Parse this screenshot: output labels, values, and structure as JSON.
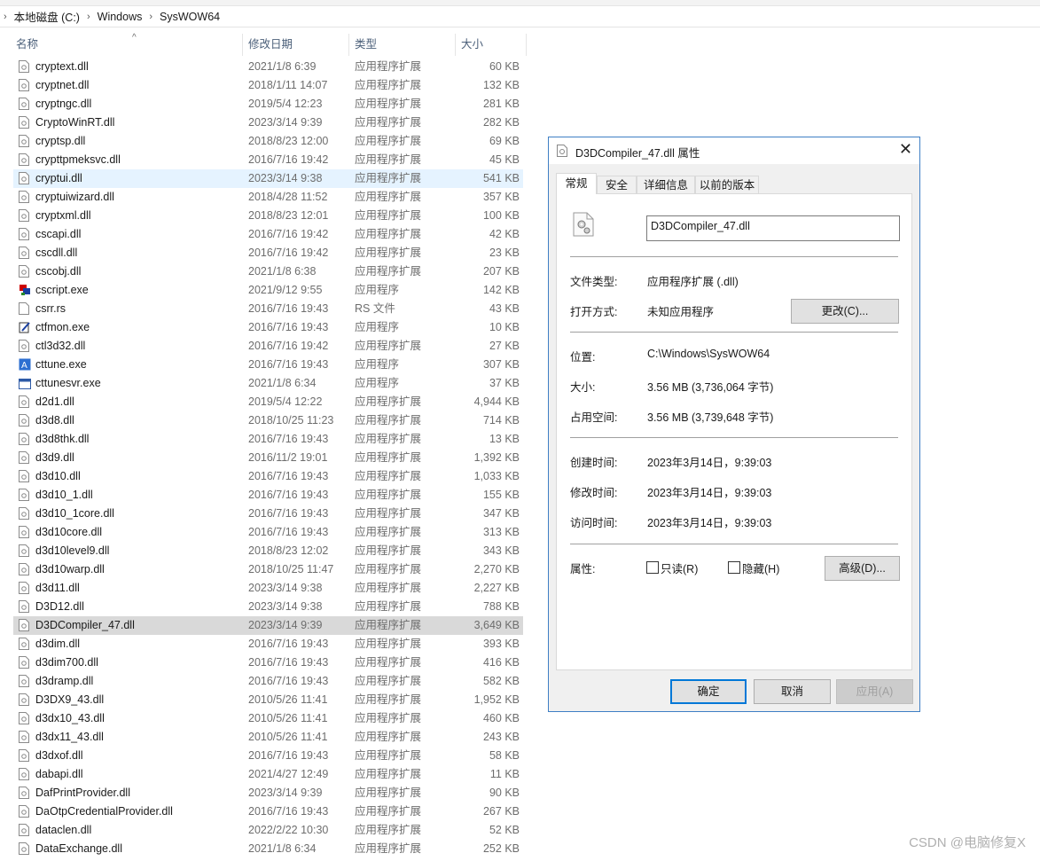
{
  "address": {
    "parts": [
      "本地磁盘 (C:)",
      "Windows",
      "SysWOW64"
    ]
  },
  "columns": {
    "name": "名称",
    "date": "修改日期",
    "type": "类型",
    "size": "大小"
  },
  "files": [
    {
      "name": "cryptext.dll",
      "date": "2021/1/8 6:39",
      "type": "应用程序扩展",
      "size": "60 KB",
      "icon": "dll-file-icon"
    },
    {
      "name": "cryptnet.dll",
      "date": "2018/1/11 14:07",
      "type": "应用程序扩展",
      "size": "132 KB",
      "icon": "dll-file-icon"
    },
    {
      "name": "cryptngc.dll",
      "date": "2019/5/4 12:23",
      "type": "应用程序扩展",
      "size": "281 KB",
      "icon": "dll-file-icon"
    },
    {
      "name": "CryptoWinRT.dll",
      "date": "2023/3/14 9:39",
      "type": "应用程序扩展",
      "size": "282 KB",
      "icon": "dll-file-icon"
    },
    {
      "name": "cryptsp.dll",
      "date": "2018/8/23 12:00",
      "type": "应用程序扩展",
      "size": "69 KB",
      "icon": "dll-file-icon"
    },
    {
      "name": "crypttpmeksvc.dll",
      "date": "2016/7/16 19:42",
      "type": "应用程序扩展",
      "size": "45 KB",
      "icon": "dll-file-icon"
    },
    {
      "name": "cryptui.dll",
      "date": "2023/3/14 9:38",
      "type": "应用程序扩展",
      "size": "541 KB",
      "icon": "dll-file-icon"
    },
    {
      "name": "cryptuiwizard.dll",
      "date": "2018/4/28 11:52",
      "type": "应用程序扩展",
      "size": "357 KB",
      "icon": "dll-file-icon"
    },
    {
      "name": "cryptxml.dll",
      "date": "2018/8/23 12:01",
      "type": "应用程序扩展",
      "size": "100 KB",
      "icon": "dll-file-icon"
    },
    {
      "name": "cscapi.dll",
      "date": "2016/7/16 19:42",
      "type": "应用程序扩展",
      "size": "42 KB",
      "icon": "dll-file-icon"
    },
    {
      "name": "cscdll.dll",
      "date": "2016/7/16 19:42",
      "type": "应用程序扩展",
      "size": "23 KB",
      "icon": "dll-file-icon"
    },
    {
      "name": "cscobj.dll",
      "date": "2021/1/8 6:38",
      "type": "应用程序扩展",
      "size": "207 KB",
      "icon": "dll-file-icon"
    },
    {
      "name": "cscript.exe",
      "date": "2021/9/12 9:55",
      "type": "应用程序",
      "size": "142 KB",
      "icon": "script-host-icon"
    },
    {
      "name": "csrr.rs",
      "date": "2016/7/16 19:43",
      "type": "RS 文件",
      "size": "43 KB",
      "icon": "blank-file-icon"
    },
    {
      "name": "ctfmon.exe",
      "date": "2016/7/16 19:43",
      "type": "应用程序",
      "size": "10 KB",
      "icon": "pen-app-icon"
    },
    {
      "name": "ctl3d32.dll",
      "date": "2016/7/16 19:42",
      "type": "应用程序扩展",
      "size": "27 KB",
      "icon": "dll-file-icon"
    },
    {
      "name": "cttune.exe",
      "date": "2016/7/16 19:43",
      "type": "应用程序",
      "size": "307 KB",
      "icon": "cleartype-icon"
    },
    {
      "name": "cttunesvr.exe",
      "date": "2021/1/8 6:34",
      "type": "应用程序",
      "size": "37 KB",
      "icon": "window-app-icon"
    },
    {
      "name": "d2d1.dll",
      "date": "2019/5/4 12:22",
      "type": "应用程序扩展",
      "size": "4,944 KB",
      "icon": "dll-file-icon"
    },
    {
      "name": "d3d8.dll",
      "date": "2018/10/25 11:23",
      "type": "应用程序扩展",
      "size": "714 KB",
      "icon": "dll-file-icon"
    },
    {
      "name": "d3d8thk.dll",
      "date": "2016/7/16 19:43",
      "type": "应用程序扩展",
      "size": "13 KB",
      "icon": "dll-file-icon"
    },
    {
      "name": "d3d9.dll",
      "date": "2016/11/2 19:01",
      "type": "应用程序扩展",
      "size": "1,392 KB",
      "icon": "dll-file-icon"
    },
    {
      "name": "d3d10.dll",
      "date": "2016/7/16 19:43",
      "type": "应用程序扩展",
      "size": "1,033 KB",
      "icon": "dll-file-icon"
    },
    {
      "name": "d3d10_1.dll",
      "date": "2016/7/16 19:43",
      "type": "应用程序扩展",
      "size": "155 KB",
      "icon": "dll-file-icon"
    },
    {
      "name": "d3d10_1core.dll",
      "date": "2016/7/16 19:43",
      "type": "应用程序扩展",
      "size": "347 KB",
      "icon": "dll-file-icon"
    },
    {
      "name": "d3d10core.dll",
      "date": "2016/7/16 19:43",
      "type": "应用程序扩展",
      "size": "313 KB",
      "icon": "dll-file-icon"
    },
    {
      "name": "d3d10level9.dll",
      "date": "2018/8/23 12:02",
      "type": "应用程序扩展",
      "size": "343 KB",
      "icon": "dll-file-icon"
    },
    {
      "name": "d3d10warp.dll",
      "date": "2018/10/25 11:47",
      "type": "应用程序扩展",
      "size": "2,270 KB",
      "icon": "dll-file-icon"
    },
    {
      "name": "d3d11.dll",
      "date": "2023/3/14 9:38",
      "type": "应用程序扩展",
      "size": "2,227 KB",
      "icon": "dll-file-icon"
    },
    {
      "name": "D3D12.dll",
      "date": "2023/3/14 9:38",
      "type": "应用程序扩展",
      "size": "788 KB",
      "icon": "dll-file-icon"
    },
    {
      "name": "D3DCompiler_47.dll",
      "date": "2023/3/14 9:39",
      "type": "应用程序扩展",
      "size": "3,649 KB",
      "icon": "dll-file-icon"
    },
    {
      "name": "d3dim.dll",
      "date": "2016/7/16 19:43",
      "type": "应用程序扩展",
      "size": "393 KB",
      "icon": "dll-file-icon"
    },
    {
      "name": "d3dim700.dll",
      "date": "2016/7/16 19:43",
      "type": "应用程序扩展",
      "size": "416 KB",
      "icon": "dll-file-icon"
    },
    {
      "name": "d3dramp.dll",
      "date": "2016/7/16 19:43",
      "type": "应用程序扩展",
      "size": "582 KB",
      "icon": "dll-file-icon"
    },
    {
      "name": "D3DX9_43.dll",
      "date": "2010/5/26 11:41",
      "type": "应用程序扩展",
      "size": "1,952 KB",
      "icon": "dll-file-icon"
    },
    {
      "name": "d3dx10_43.dll",
      "date": "2010/5/26 11:41",
      "type": "应用程序扩展",
      "size": "460 KB",
      "icon": "dll-file-icon"
    },
    {
      "name": "d3dx11_43.dll",
      "date": "2010/5/26 11:41",
      "type": "应用程序扩展",
      "size": "243 KB",
      "icon": "dll-file-icon"
    },
    {
      "name": "d3dxof.dll",
      "date": "2016/7/16 19:43",
      "type": "应用程序扩展",
      "size": "58 KB",
      "icon": "dll-file-icon"
    },
    {
      "name": "dabapi.dll",
      "date": "2021/4/27 12:49",
      "type": "应用程序扩展",
      "size": "11 KB",
      "icon": "dll-file-icon"
    },
    {
      "name": "DafPrintProvider.dll",
      "date": "2023/3/14 9:39",
      "type": "应用程序扩展",
      "size": "90 KB",
      "icon": "dll-file-icon"
    },
    {
      "name": "DaOtpCredentialProvider.dll",
      "date": "2016/7/16 19:43",
      "type": "应用程序扩展",
      "size": "267 KB",
      "icon": "dll-file-icon"
    },
    {
      "name": "dataclen.dll",
      "date": "2022/2/22 10:30",
      "type": "应用程序扩展",
      "size": "52 KB",
      "icon": "dll-file-icon"
    },
    {
      "name": "DataExchange.dll",
      "date": "2021/1/8 6:34",
      "type": "应用程序扩展",
      "size": "252 KB",
      "icon": "dll-file-icon"
    }
  ],
  "hover_row": "cryptui.dll",
  "selected_row": "D3DCompiler_47.dll",
  "dialog": {
    "title": "D3DCompiler_47.dll 属性",
    "tabs": [
      "常规",
      "安全",
      "详细信息",
      "以前的版本"
    ],
    "filename": "D3DCompiler_47.dll",
    "file_type_label": "文件类型:",
    "file_type_value": "应用程序扩展 (.dll)",
    "open_with_label": "打开方式:",
    "open_with_value": "未知应用程序",
    "change_button": "更改(C)...",
    "location_label": "位置:",
    "location_value": "C:\\Windows\\SysWOW64",
    "size_label": "大小:",
    "size_value": "3.56 MB (3,736,064 字节)",
    "disk_size_label": "占用空间:",
    "disk_size_value": "3.56 MB (3,739,648 字节)",
    "created_label": "创建时间:",
    "created_value": "2023年3月14日，9:39:03",
    "modified_label": "修改时间:",
    "modified_value": "2023年3月14日，9:39:03",
    "accessed_label": "访问时间:",
    "accessed_value": "2023年3月14日，9:39:03",
    "attributes_label": "属性:",
    "readonly_label": "只读(R)",
    "hidden_label": "隐藏(H)",
    "advanced_button": "高级(D)...",
    "ok_button": "确定",
    "cancel_button": "取消",
    "apply_button": "应用(A)"
  },
  "watermark": "CSDN @电脑修复X",
  "colors": {
    "accent": "#0078d7",
    "hover": "#e5f3ff",
    "selected": "#d9d9d9",
    "dialog_border": "#3f7fc5"
  }
}
